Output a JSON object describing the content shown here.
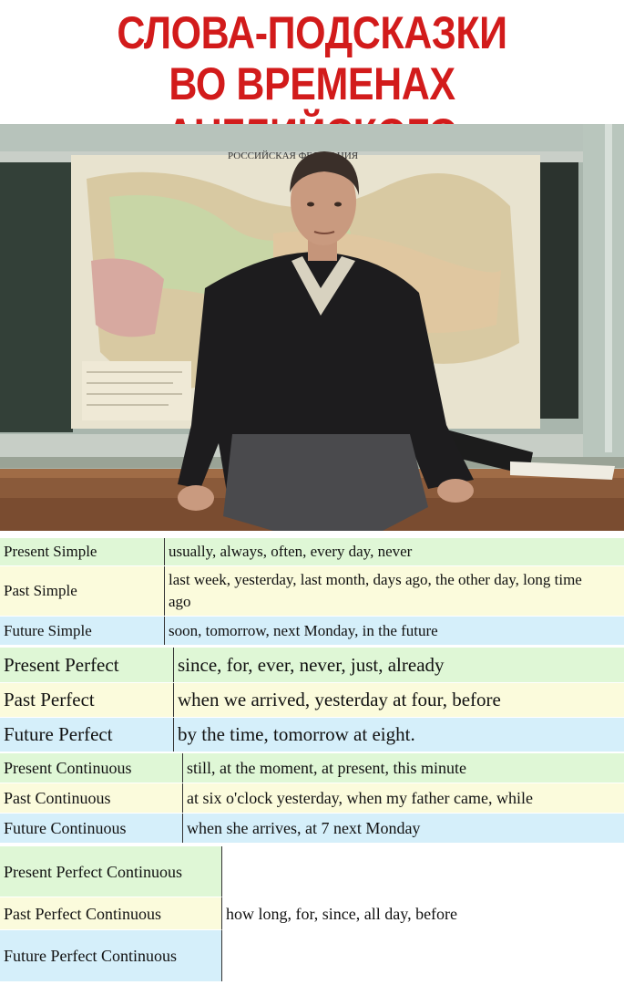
{
  "title": {
    "line1": "СЛОВА-ПОДСКАЗКИ",
    "line2": "ВО ВРЕМЕНАХ АНГЛИЙСКОГО"
  },
  "photo": {
    "map_caption": "РОССИЙСКАЯ ФЕДЕРАЦИЯ"
  },
  "simple": [
    {
      "tense": "Present Simple",
      "markers": "usually, always, often, every day, never"
    },
    {
      "tense": "Past Simple",
      "markers": "last week, yesterday, last month, days ago, the other day, long time ago"
    },
    {
      "tense": "Future Simple",
      "markers": "soon, tomorrow, next Monday, in the future"
    }
  ],
  "perfect": [
    {
      "tense": "Present Perfect",
      "markers": "since, for, ever, never, just, already"
    },
    {
      "tense": "Past Perfect",
      "markers": "when we arrived, yesterday at four, before"
    },
    {
      "tense": "Future Perfect",
      "markers": "by the time, tomorrow at eight."
    }
  ],
  "continuous": [
    {
      "tense": "Present Continuous",
      "markers": "still, at the moment, at present, this minute"
    },
    {
      "tense": "Past Continuous",
      "markers": "at six o'clock yesterday, when my father came, while"
    },
    {
      "tense": "Future Continuous",
      "markers": "when she arrives, at 7 next Monday"
    }
  ],
  "perfect_continuous": {
    "tenses": [
      "Present Perfect Continuous",
      "Past Perfect Continuous",
      "Future Perfect Continuous"
    ],
    "markers": "how long, for, since, all day, before"
  }
}
